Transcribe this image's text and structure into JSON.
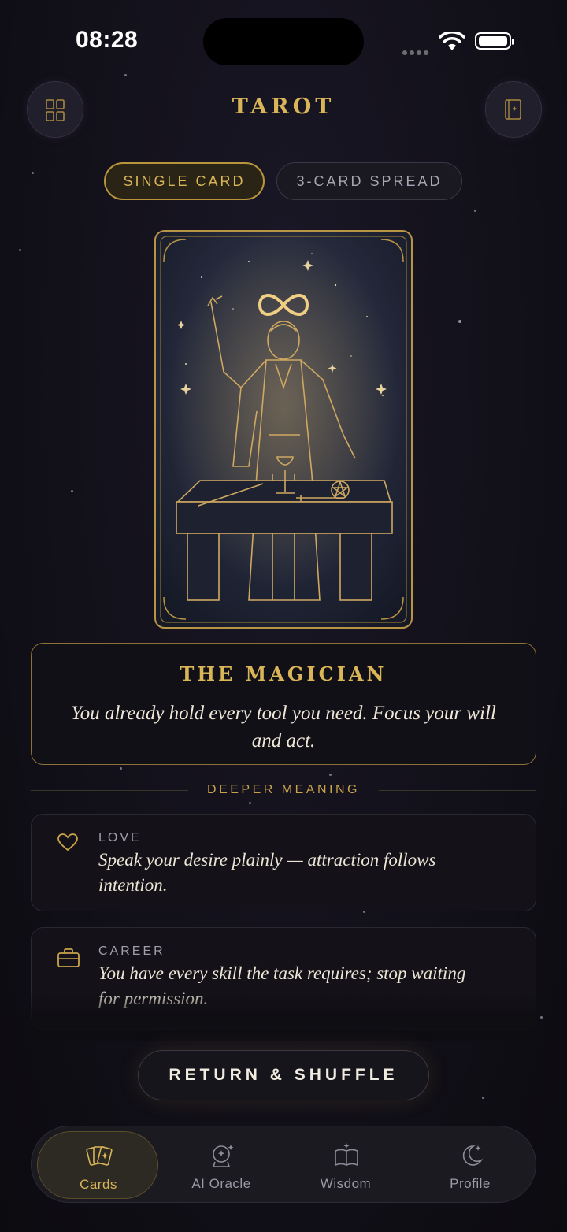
{
  "status_bar": {
    "time": "08:28"
  },
  "header": {
    "title": "TAROT",
    "left_icon": "grid-icon",
    "right_icon": "book-icon"
  },
  "mode_tabs": [
    {
      "label": "SINGLE CARD",
      "active": true
    },
    {
      "label": "3-CARD SPREAD",
      "active": false
    }
  ],
  "card": {
    "name": "THE MAGICIAN",
    "message": "You already hold every tool you need. Focus your will and act."
  },
  "deeper_meaning": {
    "heading": "DEEPER MEANING",
    "items": [
      {
        "icon": "heart-icon",
        "category": "LOVE",
        "text": "Speak your desire plainly — attraction follows intention."
      },
      {
        "icon": "briefcase-icon",
        "category": "CAREER",
        "text": "You have every skill the task requires; stop waiting for permission."
      }
    ]
  },
  "actions": {
    "return_shuffle": "RETURN & SHUFFLE"
  },
  "tab_bar": [
    {
      "label": "Cards",
      "icon": "cards-icon",
      "active": true
    },
    {
      "label": "AI Oracle",
      "icon": "crystal-ball-icon",
      "active": false
    },
    {
      "label": "Wisdom",
      "icon": "open-book-icon",
      "active": false
    },
    {
      "label": "Profile",
      "icon": "moon-icon",
      "active": false
    }
  ],
  "colors": {
    "accent_gold": "#d9b558",
    "background": "#121019"
  }
}
